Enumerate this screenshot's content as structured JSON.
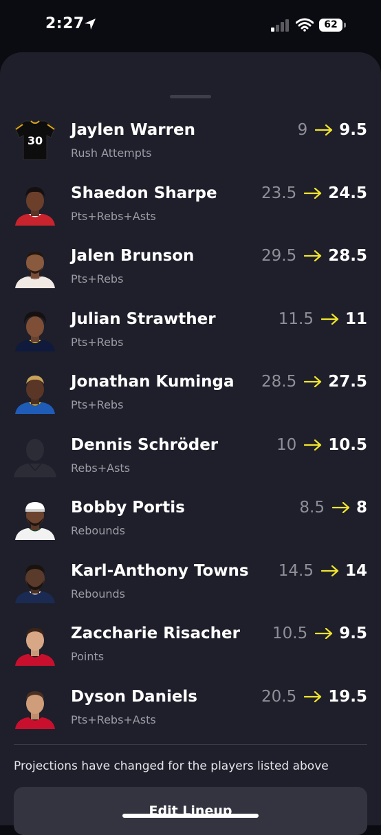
{
  "status_bar": {
    "time": "2:27",
    "battery": "62"
  },
  "players": [
    {
      "name": "Jaylen Warren",
      "stat": "Rush Attempts",
      "old": "9",
      "new": "9.5",
      "avatar": "jersey-icon",
      "jersey_number": "30"
    },
    {
      "name": "Shaedon Sharpe",
      "stat": "Pts+Rebs+Asts",
      "old": "23.5",
      "new": "24.5",
      "avatar": "player-headshot"
    },
    {
      "name": "Jalen Brunson",
      "stat": "Pts+Rebs",
      "old": "29.5",
      "new": "28.5",
      "avatar": "player-headshot"
    },
    {
      "name": "Julian Strawther",
      "stat": "Pts+Rebs",
      "old": "11.5",
      "new": "11",
      "avatar": "player-headshot"
    },
    {
      "name": "Jonathan Kuminga",
      "stat": "Pts+Rebs",
      "old": "28.5",
      "new": "27.5",
      "avatar": "player-headshot"
    },
    {
      "name": "Dennis Schröder",
      "stat": "Rebs+Asts",
      "old": "10",
      "new": "10.5",
      "avatar": "silhouette-icon"
    },
    {
      "name": "Bobby Portis",
      "stat": "Rebounds",
      "old": "8.5",
      "new": "8",
      "avatar": "player-headshot"
    },
    {
      "name": "Karl-Anthony Towns",
      "stat": "Rebounds",
      "old": "14.5",
      "new": "14",
      "avatar": "player-headshot"
    },
    {
      "name": "Zaccharie Risacher",
      "stat": "Points",
      "old": "10.5",
      "new": "9.5",
      "avatar": "player-headshot"
    },
    {
      "name": "Dyson Daniels",
      "stat": "Pts+Rebs+Asts",
      "old": "20.5",
      "new": "19.5",
      "avatar": "player-headshot"
    }
  ],
  "note": "Projections have changed for the players listed above",
  "edit_button_label": "Edit Lineup",
  "colors": {
    "background": "#0b0c11",
    "sheet": "#1e1f2a",
    "arrow": "#f2e52e",
    "muted_text": "#9c9ca6"
  }
}
